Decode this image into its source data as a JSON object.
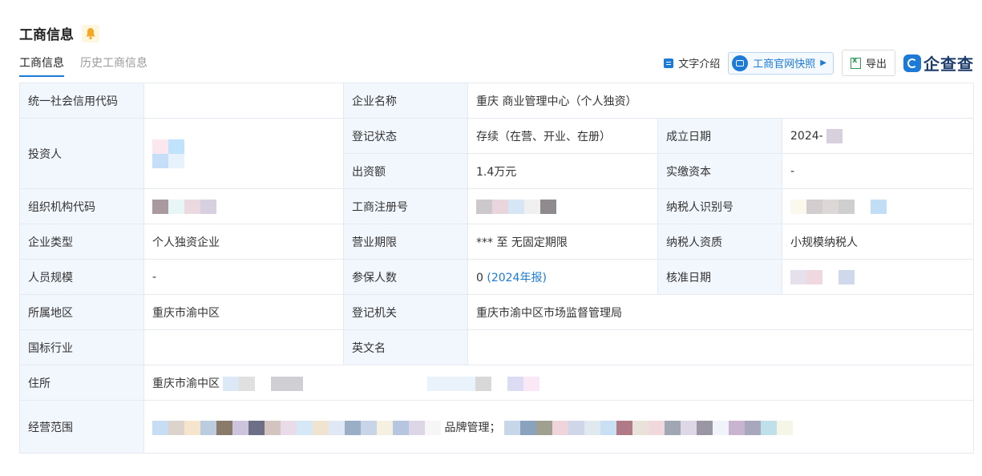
{
  "header": {
    "title": "工商信息",
    "bell_icon": "bell-icon"
  },
  "tabs": [
    {
      "label": "工商信息",
      "active": true
    },
    {
      "label": "历史工商信息",
      "active": false
    }
  ],
  "actions": {
    "text_intro": "文字介绍",
    "snapshot": "工商官网快照",
    "export": "导出",
    "logo": "企查查"
  },
  "rows": {
    "credit_code_label": "统一社会信用代码",
    "company_name_label": "企业名称",
    "company_name": "重庆 商业管理中心（个人独资）",
    "investor_label": "投资人",
    "reg_status_label": "登记状态",
    "reg_status": "存续（在营、开业、在册）",
    "founded_label": "成立日期",
    "founded": "2024-",
    "capital_label": "出资额",
    "capital": "1.4万元",
    "paid_capital_label": "实缴资本",
    "paid_capital": "-",
    "org_code_label": "组织机构代码",
    "reg_no_label": "工商注册号",
    "taxpayer_id_label": "纳税人识别号",
    "type_label": "企业类型",
    "type": "个人独资企业",
    "term_label": "营业期限",
    "term": "*** 至 无固定期限",
    "taxpayer_qual_label": "纳税人资质",
    "taxpayer_qual": "小规模纳税人",
    "staff_label": "人员规模",
    "staff": "-",
    "insured_label": "参保人数",
    "insured": "0",
    "insured_report": "(2024年报)",
    "approved_label": "核准日期",
    "region_label": "所属地区",
    "region": "重庆市渝中区",
    "authority_label": "登记机关",
    "authority": "重庆市渝中区市场监督管理局",
    "industry_label": "国标行业",
    "english_label": "英文名",
    "address_label": "住所",
    "address": "重庆市渝中区",
    "scope_label": "经营范围",
    "scope_fragment": "品牌管理；"
  },
  "colors": {
    "accent": "#1c7bd6",
    "label_bg": "#f2f7fd",
    "border": "#e5eaf1"
  }
}
